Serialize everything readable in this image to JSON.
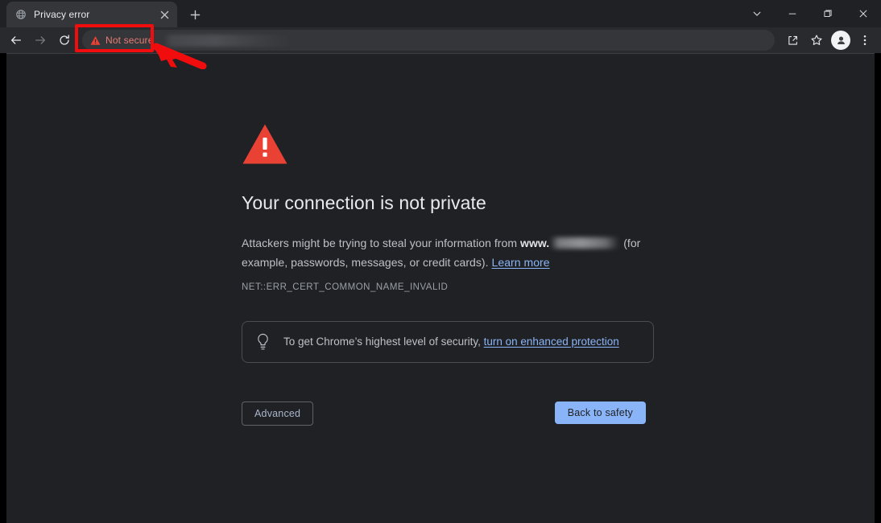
{
  "window": {
    "title": "Privacy error",
    "controls": {
      "tab_search": "tab-search",
      "minimize": "minimize",
      "maximize": "maximize",
      "close": "close"
    }
  },
  "tabstrip": {
    "tabs": [
      {
        "title": "Privacy error",
        "favicon": "globe-icon",
        "close": "×",
        "active": true
      }
    ],
    "new_tab_label": "+"
  },
  "toolbar": {
    "back": "back-arrow-icon",
    "forward": "forward-arrow-icon",
    "reload": "reload-icon",
    "security_chip": {
      "icon": "warning-triangle-icon",
      "label": "Not secure",
      "color": "#e67c73"
    },
    "url_value": "",
    "url_redacted": true,
    "share": "share-icon",
    "bookmark": "star-icon",
    "profile": "profile-avatar-icon",
    "menu": "three-dot-menu-icon"
  },
  "page": {
    "warning_icon": "red-warning-triangle",
    "heading": "Your connection is not private",
    "body_part1": "Attackers might be trying to steal your information from ",
    "body_host_prefix": "www.",
    "body_host_redacted": true,
    "body_part2": " (for example, passwords, messages, or credit cards). ",
    "learn_more": "Learn more",
    "error_code": "NET::ERR_CERT_COMMON_NAME_INVALID",
    "protection": {
      "icon": "lightbulb-icon",
      "text": "To get Chrome’s highest level of security, ",
      "link": "turn on enhanced protection"
    },
    "buttons": {
      "advanced": "Advanced",
      "back_to_safety": "Back to safety"
    }
  },
  "annotations": {
    "highlight_box": "red-rectangle-around-not-secure",
    "arrow": "red-arrow-pointing-to-not-secure",
    "color": "#f10d0d"
  },
  "colors": {
    "chrome_frame": "#202124",
    "toolbar": "#292a2d",
    "tab_active": "#35363a",
    "page_bg": "#202124",
    "link": "#8ab4f8",
    "warning_red": "#e94235",
    "annotation_red": "#f10d0d"
  }
}
